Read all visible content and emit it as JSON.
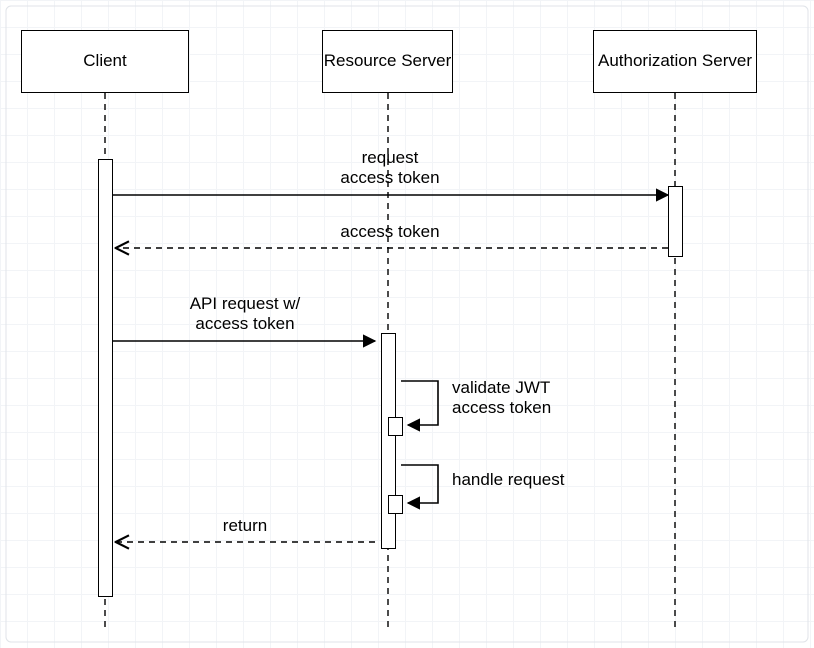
{
  "participants": {
    "client": "Client",
    "resource_server": "Resource\nServer",
    "authorization_server": "Authorization\nServer"
  },
  "messages": {
    "m1": "request\naccess token",
    "m2": "access token",
    "m3": "API request w/\naccess token",
    "m4": "validate JWT\naccess token",
    "m5": "handle request",
    "m6": "return"
  }
}
